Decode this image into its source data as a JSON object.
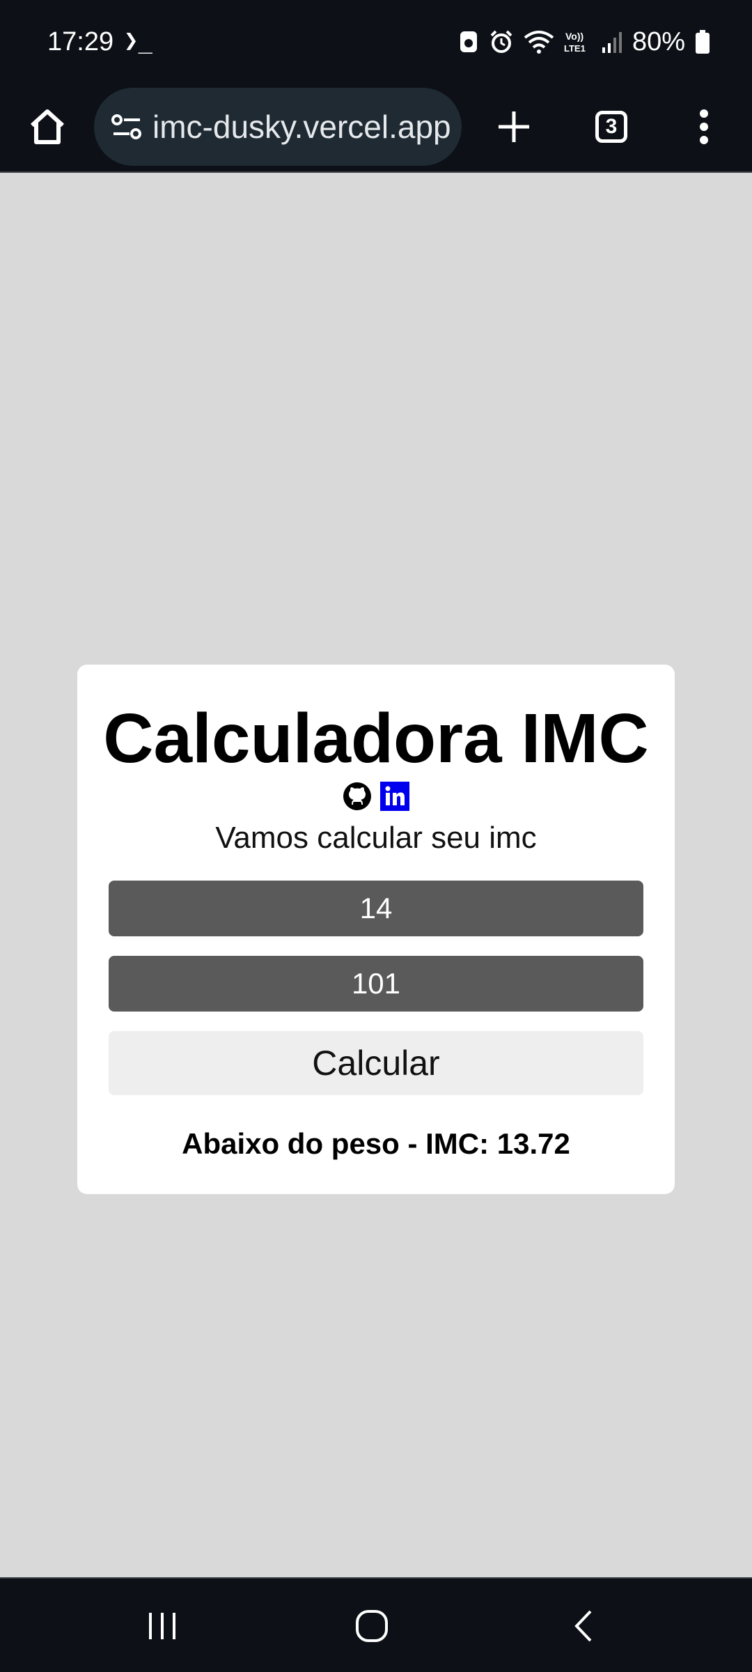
{
  "status_bar": {
    "time": "17:29",
    "terminal_glyph": "❯_",
    "battery": "80%"
  },
  "browser": {
    "url": "imc-dusky.vercel.app",
    "tab_count": "3"
  },
  "card": {
    "title": "Calculadora IMC",
    "subtitle": "Vamos calcular seu imc",
    "height_value": "14",
    "weight_value": "101",
    "calculate_label": "Calcular",
    "result": "Abaixo do peso - IMC: 13.72"
  },
  "icons": {
    "github": "github-icon",
    "linkedin": "linkedin-icon"
  },
  "colors": {
    "linkedin_bg": "#0000ee",
    "field_bg": "#5a5a5a",
    "page_bg": "#d9d9d9"
  }
}
